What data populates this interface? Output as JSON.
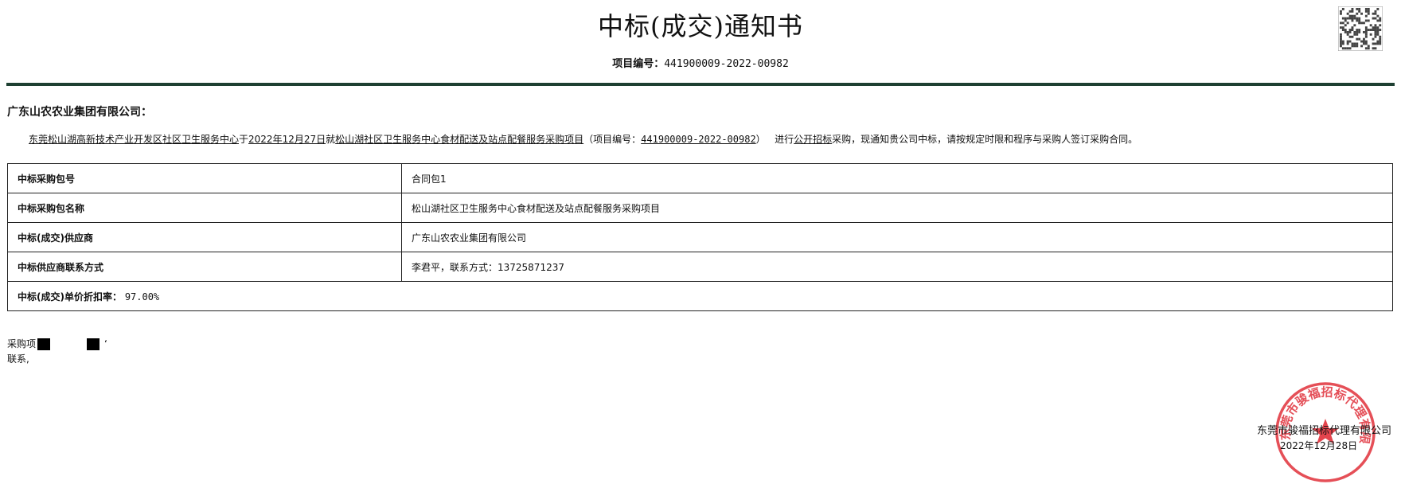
{
  "header": {
    "title": "中标(成交)通知书",
    "project_no_label": "项目编号：",
    "project_no": "441900009-2022-00982"
  },
  "addressee": "广东山农农业集团有限公司：",
  "notice": {
    "purchaser": "东莞松山湖高新技术产业开发区社区卫生服务中心",
    "yu": "于",
    "date": "2022年12月27日",
    "jiu": "就",
    "project_name": "松山湖社区卫生服务中心食材配送及站点配餐服务采购项目",
    "no_prefix": "（项目编号：",
    "project_no": "441900009-2022-00982",
    "no_suffix": "）",
    "method_prefix": "进行",
    "method": "公开招标",
    "rest": "采购，现通知贵公司中标，请按规定时限和程序与采购人签订采购合同。"
  },
  "table": {
    "rows": [
      {
        "key": "中标采购包号",
        "value": "合同包1"
      },
      {
        "key": "中标采购包名称",
        "value": "松山湖社区卫生服务中心食材配送及站点配餐服务采购项目"
      },
      {
        "key": "中标(成交)供应商",
        "value": "广东山农农业集团有限公司"
      },
      {
        "key": "中标供应商联系方式",
        "value": "李君平，联系方式：13725871237"
      }
    ],
    "discount_label": "中标(成交)单价折扣率：",
    "discount_value": "97.00%"
  },
  "contact": {
    "line1_prefix": "采购项",
    "line1_end": "‘",
    "line2": "联系,"
  },
  "footer": {
    "agency": "东莞市骏福招标代理有限公司",
    "date": "2022年12月28日"
  },
  "seal": {
    "color": "#e0303a",
    "text": "东莞市骏福招标代理有限公司"
  },
  "colors": {
    "rule": "#1e4032"
  }
}
